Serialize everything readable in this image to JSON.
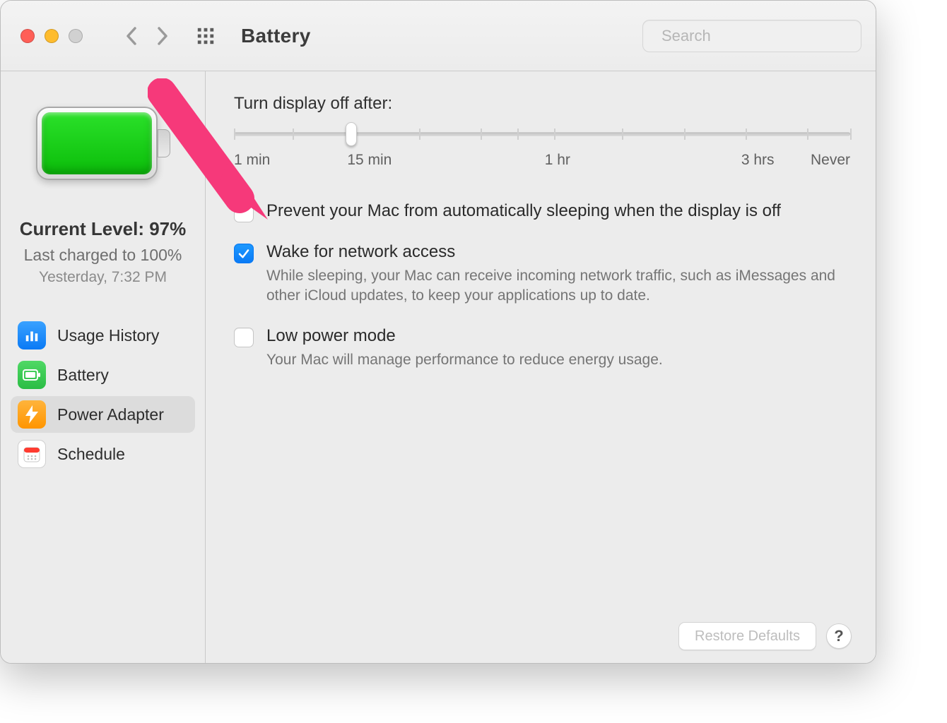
{
  "toolbar": {
    "title": "Battery",
    "search_placeholder": "Search"
  },
  "sidebar": {
    "current_level": "Current Level: 97%",
    "last_charged": "Last charged to 100%",
    "last_charged_date": "Yesterday, 7:32 PM",
    "items": [
      {
        "label": "Usage History",
        "selected": false
      },
      {
        "label": "Battery",
        "selected": false
      },
      {
        "label": "Power Adapter",
        "selected": true
      },
      {
        "label": "Schedule",
        "selected": false
      }
    ]
  },
  "main": {
    "slider_label": "Turn display off after:",
    "slider_ticks": [
      "1 min",
      "15 min",
      "1 hr",
      "3 hrs",
      "Never"
    ],
    "options": {
      "prevent_sleep": {
        "checked": false,
        "title": "Prevent your Mac from automatically sleeping when the display is off"
      },
      "wake_network": {
        "checked": true,
        "title": "Wake for network access",
        "desc": "While sleeping, your Mac can receive incoming network traffic, such as iMessages and other iCloud updates, to keep your applications up to date."
      },
      "low_power": {
        "checked": false,
        "title": "Low power mode",
        "desc": "Your Mac will manage performance to reduce energy usage."
      }
    },
    "restore_defaults": "Restore Defaults",
    "help": "?"
  }
}
